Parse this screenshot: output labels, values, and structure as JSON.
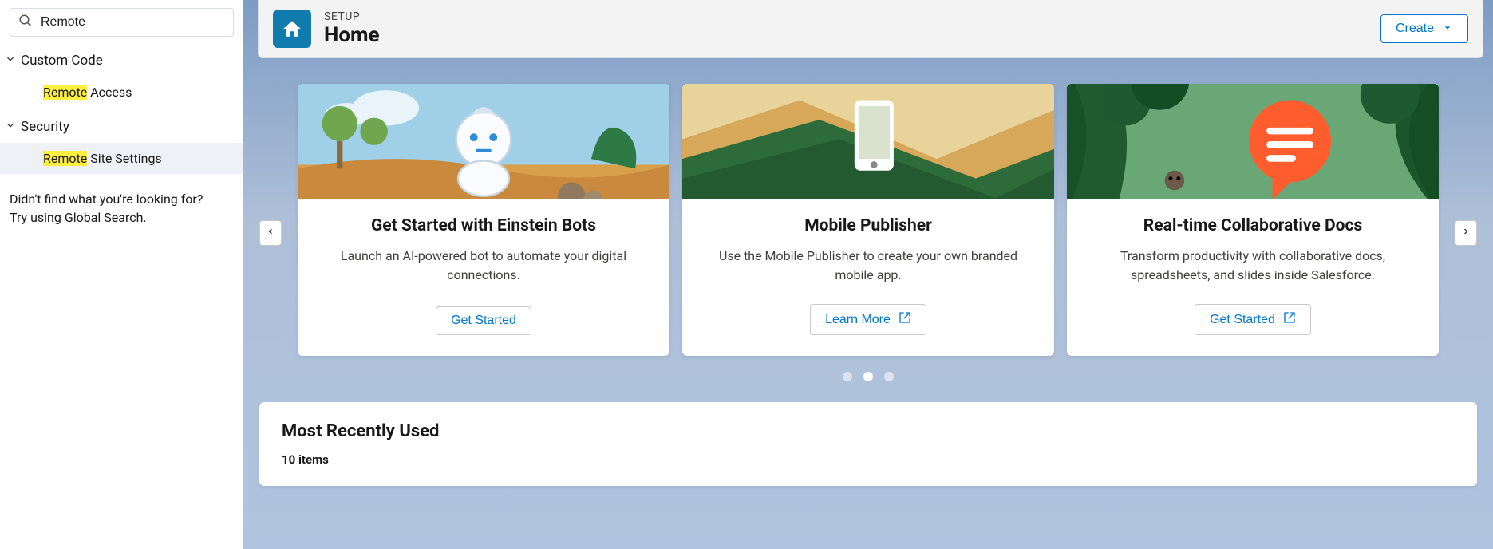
{
  "search": {
    "value": "Remote"
  },
  "tree": {
    "sections": [
      {
        "label": "Custom Code",
        "items": [
          {
            "prefix": "Remote",
            "suffix": " Access",
            "selected": false
          }
        ]
      },
      {
        "label": "Security",
        "items": [
          {
            "prefix": "Remote",
            "suffix": " Site Settings",
            "selected": true
          }
        ]
      }
    ],
    "help_line1": "Didn't find what you're looking for?",
    "help_line2": "Try using Global Search."
  },
  "header": {
    "eyebrow": "SETUP",
    "title": "Home",
    "create_label": "Create"
  },
  "cards": [
    {
      "title": "Get Started with Einstein Bots",
      "desc": "Launch an AI-powered bot to automate your digital connections.",
      "button": "Get Started",
      "external": false
    },
    {
      "title": "Mobile Publisher",
      "desc": "Use the Mobile Publisher to create your own branded mobile app.",
      "button": "Learn More",
      "external": true
    },
    {
      "title": "Real-time Collaborative Docs",
      "desc": "Transform productivity with collaborative docs, spreadsheets, and slides inside Salesforce.",
      "button": "Get Started",
      "external": true
    }
  ],
  "carousel": {
    "active_dot": 1,
    "dot_count": 3
  },
  "recent": {
    "title": "Most Recently Used",
    "count_label": "10 items"
  }
}
